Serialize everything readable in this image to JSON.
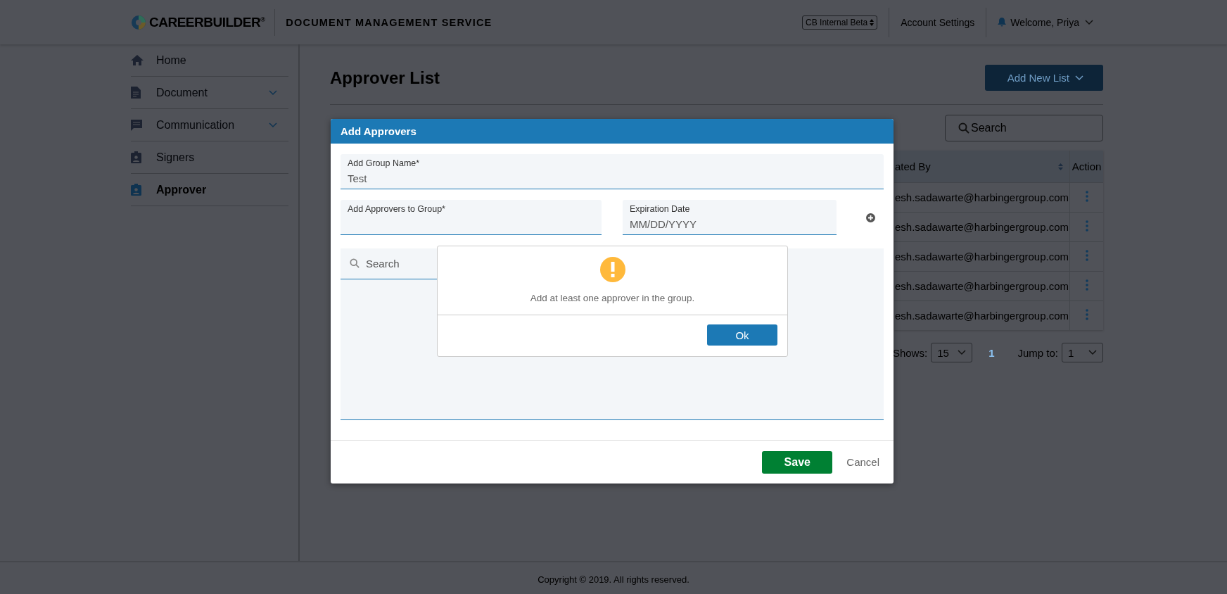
{
  "header": {
    "logo": "CAREERBUILDER$^{®}$",
    "service_title": "DOCUMENT MANAGEMENT SERVICE",
    "environment_select": "CB Internal Beta",
    "account_settings": "Account Settings",
    "welcome": "Welcome, Priya"
  },
  "sidebar": {
    "items": [
      {
        "label": "Home",
        "expandable": false,
        "selected": false
      },
      {
        "label": "Document",
        "expandable": true,
        "selected": false
      },
      {
        "label": "Communication",
        "expandable": true,
        "selected": false
      },
      {
        "label": "Signers",
        "expandable": false,
        "selected": false
      },
      {
        "label": "Approver",
        "expandable": false,
        "selected": true
      }
    ]
  },
  "page": {
    "title": "Approver List",
    "add_button": "Add New List",
    "search": {
      "placeholder": "Search"
    },
    "table": {
      "columns": [
        {
          "label": "ated By",
          "sortable": true
        },
        {
          "label": "Action",
          "sortable": false
        }
      ],
      "rows": [
        {
          "column_1": "esh.sadawarte@harbingergroup.com"
        },
        {
          "column_1": "esh.sadawarte@harbingergroup.com"
        },
        {
          "column_1": "esh.sadawarte@harbingergroup.com"
        },
        {
          "column_1": "esh.sadawarte@harbingergroup.com"
        },
        {
          "column_1": "esh.sadawarte@harbingergroup.com"
        }
      ]
    },
    "pagination": {
      "shows_label": "Shows:",
      "page_size": "15",
      "current_page": "1",
      "jump_label": "Jump to:",
      "jump_value": "1"
    }
  },
  "modal": {
    "title": "Add Approvers",
    "group_name": {
      "label": "Add Group Name*",
      "value": "Test"
    },
    "approvers": {
      "label": "Add Approvers to Group*"
    },
    "expiration": {
      "label": "Expiration Date",
      "placeholder": "MM/DD/YYYY"
    },
    "search": {
      "placeholder": "Search"
    },
    "save": "Save",
    "cancel": "Cancel"
  },
  "alert": {
    "message": "Add at least one approver in the group.",
    "ok": "Ok"
  },
  "footer": {
    "copyright": "Copyright © 2019. All rights reserved."
  }
}
